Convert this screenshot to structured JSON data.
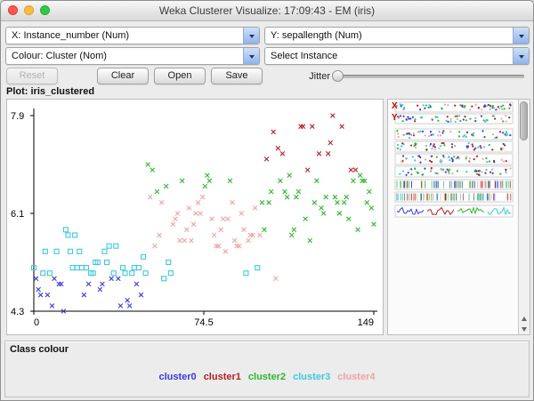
{
  "window": {
    "title": "Weka Clusterer Visualize: 17:09:43 - EM (iris)"
  },
  "controls": {
    "x_combo": "X: Instance_number (Num)",
    "y_combo": "Y: sepallength (Num)",
    "colour_combo": "Colour: Cluster (Nom)",
    "select_combo": "Select Instance",
    "buttons": {
      "reset": "Reset",
      "clear": "Clear",
      "open": "Open",
      "save": "Save"
    },
    "jitter_label": "Jitter"
  },
  "plot": {
    "title": "Plot: iris_clustered"
  },
  "matrix_panel": {
    "x_label": "X",
    "y_label": "Y"
  },
  "legend": {
    "title": "Class colour",
    "items": [
      {
        "label": "cluster0",
        "color": "#3939e0"
      },
      {
        "label": "cluster1",
        "color": "#b22222"
      },
      {
        "label": "cluster2",
        "color": "#2eb82e"
      },
      {
        "label": "cluster3",
        "color": "#3fc8dc"
      },
      {
        "label": "cluster4",
        "color": "#efa3a3"
      }
    ]
  },
  "colors": {
    "window_bg": "#ececec",
    "axis": "#000000",
    "matrix_label": "#cc0000"
  },
  "chart_data": {
    "type": "scatter",
    "title": "Plot: iris_clustered",
    "xlabel": "Instance_number",
    "ylabel": "sepallength",
    "xlim": [
      0,
      149
    ],
    "ylim": [
      4.3,
      7.9
    ],
    "x_ticks": [
      "0",
      "74.5",
      "149"
    ],
    "y_ticks": [
      "7.9",
      "6.1",
      "4.3"
    ],
    "grid": false,
    "legend_position": "bottom",
    "series": [
      {
        "name": "cluster0",
        "color": "#3939e0",
        "marker": "x",
        "points": [
          [
            1,
            4.9
          ],
          [
            2,
            4.7
          ],
          [
            3,
            4.6
          ],
          [
            6,
            4.6
          ],
          [
            8,
            4.4
          ],
          [
            9,
            4.9
          ],
          [
            11,
            4.8
          ],
          [
            12,
            4.8
          ],
          [
            13,
            4.3
          ],
          [
            22,
            4.6
          ],
          [
            24,
            4.8
          ],
          [
            29,
            4.7
          ],
          [
            30,
            4.8
          ],
          [
            34,
            4.9
          ],
          [
            37,
            4.9
          ],
          [
            38,
            4.4
          ],
          [
            41,
            4.5
          ],
          [
            42,
            4.4
          ],
          [
            45,
            4.8
          ],
          [
            47,
            4.6
          ]
        ]
      },
      {
        "name": "cluster1",
        "color": "#b22222",
        "marker": "x",
        "points": [
          [
            102,
            7.1
          ],
          [
            105,
            7.6
          ],
          [
            107,
            7.3
          ],
          [
            109,
            7.2
          ],
          [
            117,
            7.7
          ],
          [
            118,
            7.7
          ],
          [
            120,
            6.9
          ],
          [
            122,
            7.7
          ],
          [
            125,
            7.2
          ],
          [
            129,
            7.2
          ],
          [
            130,
            7.4
          ],
          [
            131,
            7.9
          ],
          [
            135,
            7.7
          ],
          [
            139,
            6.9
          ],
          [
            141,
            6.9
          ]
        ]
      },
      {
        "name": "cluster2",
        "color": "#2eb82e",
        "marker": "x",
        "points": [
          [
            50,
            7.0
          ],
          [
            52,
            6.9
          ],
          [
            54,
            6.5
          ],
          [
            58,
            6.6
          ],
          [
            65,
            6.7
          ],
          [
            75,
            6.6
          ],
          [
            76,
            6.8
          ],
          [
            77,
            6.7
          ],
          [
            86,
            6.7
          ],
          [
            100,
            6.3
          ],
          [
            101,
            5.8
          ],
          [
            103,
            6.3
          ],
          [
            104,
            6.5
          ],
          [
            108,
            6.7
          ],
          [
            110,
            6.5
          ],
          [
            111,
            6.4
          ],
          [
            112,
            6.8
          ],
          [
            113,
            5.7
          ],
          [
            114,
            5.8
          ],
          [
            115,
            6.4
          ],
          [
            116,
            6.5
          ],
          [
            119,
            6.0
          ],
          [
            121,
            5.6
          ],
          [
            123,
            6.3
          ],
          [
            124,
            6.7
          ],
          [
            126,
            6.2
          ],
          [
            127,
            6.1
          ],
          [
            128,
            6.4
          ],
          [
            132,
            6.4
          ],
          [
            133,
            6.3
          ],
          [
            134,
            6.1
          ],
          [
            136,
            6.3
          ],
          [
            137,
            6.4
          ],
          [
            138,
            6.0
          ],
          [
            140,
            6.7
          ],
          [
            142,
            5.8
          ],
          [
            143,
            6.8
          ],
          [
            144,
            6.7
          ],
          [
            145,
            6.7
          ],
          [
            146,
            6.3
          ],
          [
            147,
            6.5
          ],
          [
            148,
            6.2
          ],
          [
            149,
            5.9
          ]
        ]
      },
      {
        "name": "cluster3",
        "color": "#3fc8dc",
        "marker": "square",
        "points": [
          [
            0,
            5.1
          ],
          [
            4,
            5.0
          ],
          [
            5,
            5.4
          ],
          [
            7,
            5.0
          ],
          [
            10,
            5.4
          ],
          [
            14,
            5.8
          ],
          [
            15,
            5.7
          ],
          [
            16,
            5.4
          ],
          [
            17,
            5.1
          ],
          [
            18,
            5.7
          ],
          [
            19,
            5.1
          ],
          [
            20,
            5.4
          ],
          [
            21,
            5.1
          ],
          [
            23,
            5.1
          ],
          [
            25,
            5.0
          ],
          [
            26,
            5.0
          ],
          [
            27,
            5.2
          ],
          [
            28,
            5.2
          ],
          [
            31,
            5.4
          ],
          [
            32,
            5.2
          ],
          [
            33,
            5.5
          ],
          [
            35,
            5.0
          ],
          [
            36,
            5.5
          ],
          [
            39,
            5.1
          ],
          [
            40,
            5.0
          ],
          [
            43,
            5.0
          ],
          [
            44,
            5.1
          ],
          [
            46,
            5.1
          ],
          [
            48,
            5.3
          ],
          [
            49,
            5.0
          ],
          [
            57,
            4.9
          ],
          [
            59,
            5.2
          ],
          [
            60,
            5.0
          ],
          [
            93,
            5.0
          ],
          [
            98,
            5.1
          ]
        ]
      },
      {
        "name": "cluster4",
        "color": "#efa3a3",
        "marker": "x",
        "points": [
          [
            51,
            6.4
          ],
          [
            53,
            5.5
          ],
          [
            55,
            5.7
          ],
          [
            56,
            6.3
          ],
          [
            61,
            5.9
          ],
          [
            62,
            6.0
          ],
          [
            63,
            6.1
          ],
          [
            64,
            5.6
          ],
          [
            66,
            5.6
          ],
          [
            67,
            5.8
          ],
          [
            68,
            6.2
          ],
          [
            69,
            5.6
          ],
          [
            70,
            5.9
          ],
          [
            71,
            6.1
          ],
          [
            72,
            6.3
          ],
          [
            73,
            6.1
          ],
          [
            74,
            6.4
          ],
          [
            78,
            6.0
          ],
          [
            79,
            5.7
          ],
          [
            80,
            5.5
          ],
          [
            81,
            5.5
          ],
          [
            82,
            5.8
          ],
          [
            83,
            6.0
          ],
          [
            84,
            5.4
          ],
          [
            85,
            6.0
          ],
          [
            87,
            6.3
          ],
          [
            88,
            5.6
          ],
          [
            89,
            5.5
          ],
          [
            90,
            5.5
          ],
          [
            91,
            6.1
          ],
          [
            92,
            5.8
          ],
          [
            94,
            5.6
          ],
          [
            95,
            5.7
          ],
          [
            96,
            5.7
          ],
          [
            97,
            6.2
          ],
          [
            99,
            5.7
          ],
          [
            106,
            4.9
          ]
        ]
      }
    ]
  }
}
